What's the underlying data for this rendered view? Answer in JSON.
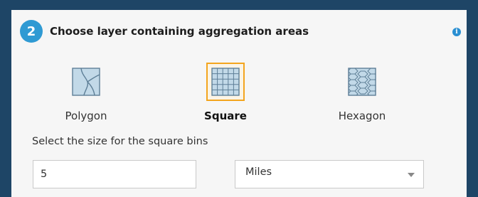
{
  "header": {
    "step_number": "2",
    "title": "Choose layer containing aggregation areas",
    "info_icon": "info-icon"
  },
  "options": [
    {
      "label": "Polygon",
      "icon": "polygon-grid-icon",
      "selected": false
    },
    {
      "label": "Square",
      "icon": "square-grid-icon",
      "selected": true
    },
    {
      "label": "Hexagon",
      "icon": "hexagon-grid-icon",
      "selected": false
    }
  ],
  "size": {
    "label": "Select the size for the square bins",
    "value": "5"
  },
  "units": {
    "selected": "Miles"
  },
  "colors": {
    "background": "#1e4566",
    "panel": "#f6f6f6",
    "badge": "#2f9ad3",
    "selected_border": "#f3a51e",
    "icon_fill": "#c2d9e8",
    "icon_stroke": "#5e7f97"
  }
}
